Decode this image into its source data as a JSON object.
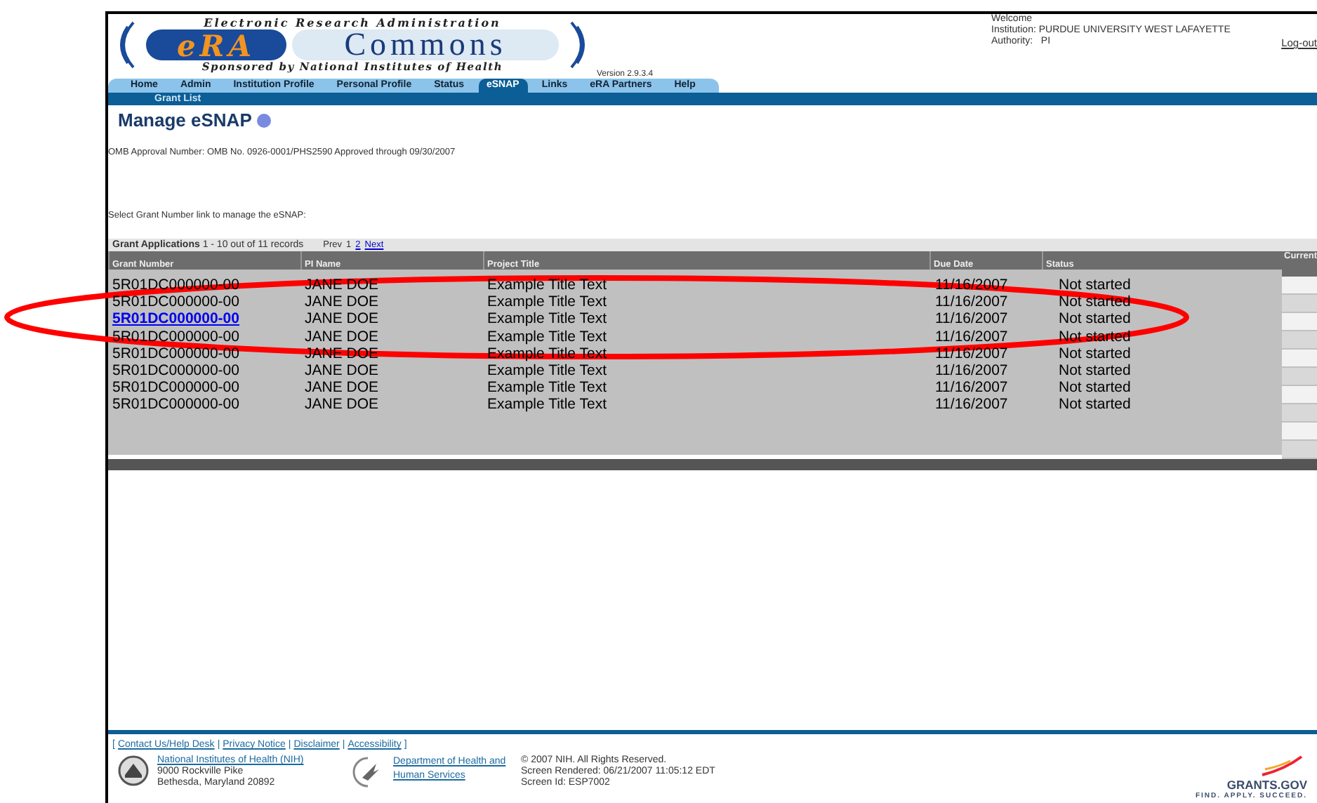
{
  "header": {
    "logo": {
      "top": "Electronic Research Administration",
      "left": "eRA",
      "right": "Commons",
      "bottom": "Sponsored by National Institutes of Health"
    },
    "version": "Version 2.9.3.4",
    "user": {
      "welcome": "Welcome",
      "institution": "Institution: PURDUE UNIVERSITY WEST LAFAYETTE",
      "authority": "Authority:   PI",
      "logout": "Log-out"
    }
  },
  "nav": {
    "tabs": [
      {
        "label": "Home",
        "selected": false
      },
      {
        "label": "Admin",
        "selected": false
      },
      {
        "label": "Institution Profile",
        "selected": false
      },
      {
        "label": "Personal Profile",
        "selected": false
      },
      {
        "label": "Status",
        "selected": false
      },
      {
        "label": "eSNAP",
        "selected": true
      },
      {
        "label": "Links",
        "selected": false
      },
      {
        "label": "eRA Partners",
        "selected": false
      },
      {
        "label": "Help",
        "selected": false
      }
    ],
    "subnav": [
      "Grant List"
    ]
  },
  "page": {
    "title": "Manage eSNAP",
    "omb": "OMB Approval Number: OMB No. 0926-0001/PHS2590 Approved through 09/30/2007",
    "instruction": "Select Grant Number link to manage the eSNAP:"
  },
  "table": {
    "caption": "Grant Applications",
    "range": "1 - 10 out of 11 records",
    "pager": [
      {
        "label": "Prev",
        "kind": "text"
      },
      {
        "label": "1",
        "kind": "text"
      },
      {
        "label": "2",
        "kind": "link"
      },
      {
        "label": "Next",
        "kind": "link"
      }
    ],
    "columns": [
      "Grant Number",
      "PI Name",
      "Project Title",
      "Due Date",
      "Status",
      "Current"
    ],
    "rows": [
      {
        "cells": [
          "5R01DC000000-00",
          "JANE DOE",
          "Example Title Text",
          "11/16/2007",
          "Not started"
        ],
        "selected": false
      },
      {
        "cells": [
          "5R01DC000000-00",
          "JANE DOE",
          "Example Title Text",
          "11/16/2007",
          "Not started"
        ],
        "selected": false
      },
      {
        "cells": [
          "5R01DC000000-00",
          "JANE DOE",
          "Example Title Text",
          "11/16/2007",
          "Not started"
        ],
        "selected": true
      },
      {
        "cells": [
          "5R01DC000000-00",
          "JANE DOE",
          "Example Title Text",
          "11/16/2007",
          "Not started"
        ],
        "selected": false
      },
      {
        "cells": [
          "5R01DC000000-00",
          "JANE DOE",
          "Example Title Text",
          "11/16/2007",
          "Not started"
        ],
        "selected": false
      },
      {
        "cells": [
          "5R01DC000000-00",
          "JANE DOE",
          "Example Title Text",
          "11/16/2007",
          "Not started"
        ],
        "selected": false
      },
      {
        "cells": [
          "5R01DC000000-00",
          "JANE DOE",
          "Example Title Text",
          "11/16/2007",
          "Not started"
        ],
        "selected": false
      },
      {
        "cells": [
          "5R01DC000000-00",
          "JANE DOE",
          "Example Title Text",
          "11/16/2007",
          "Not started"
        ],
        "selected": false
      }
    ]
  },
  "footer": {
    "links": [
      {
        "kind": "separator",
        "text": "["
      },
      {
        "kind": "link",
        "text": "Contact Us/Help Desk"
      },
      {
        "kind": "separator",
        "text": "|"
      },
      {
        "kind": "link",
        "text": "Privacy Notice"
      },
      {
        "kind": "separator",
        "text": "|"
      },
      {
        "kind": "link",
        "text": "Disclaimer"
      },
      {
        "kind": "separator",
        "text": "|"
      },
      {
        "kind": "link",
        "text": "Accessibility"
      },
      {
        "kind": "separator",
        "text": "]"
      }
    ],
    "nih": {
      "link": "National Institutes of Health (NIH)",
      "lines": [
        "9000 Rockville Pike",
        "Bethesda, Maryland 20892"
      ]
    },
    "hhs": {
      "link": "Department of Health and Human Services"
    },
    "info": [
      "© 2007 NIH. All Rights Reserved.",
      "Screen Rendered: 06/21/2007 11:05:12 EDT",
      "Screen Id: ESP7002"
    ],
    "grants": {
      "name": "GRANTS.GOV",
      "tagline": "FIND. APPLY. SUCCEED."
    }
  }
}
